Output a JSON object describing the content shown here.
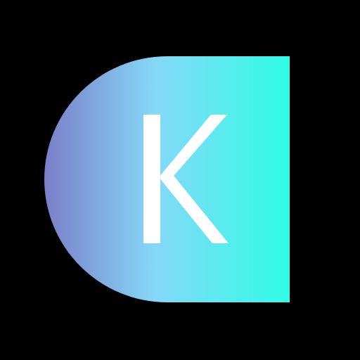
{
  "background_color": "#000000",
  "logo": {
    "letter": "K",
    "letter_color": "#ffffff",
    "gradient_colors": [
      "#7a7fc8",
      "#86d8f8",
      "#2ffde6"
    ]
  }
}
